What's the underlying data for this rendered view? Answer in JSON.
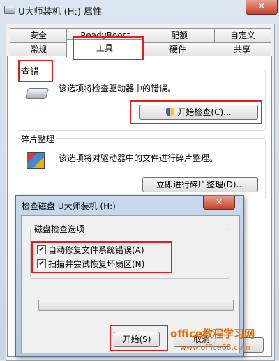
{
  "window": {
    "title": "U大师装机 (H:) 属性",
    "close_label": "✕"
  },
  "tabs_row1": [
    "安全",
    "ReadyBoost",
    "配额",
    "自定义"
  ],
  "tabs_row2": [
    "常规",
    "工具",
    "硬件",
    "共享"
  ],
  "active_tab": "工具",
  "check_section": {
    "label": "查错",
    "description": "该选项将检查驱动器中的错误。",
    "button_label": "开始检查(C)..."
  },
  "defrag_section": {
    "label": "碎片整理",
    "description": "该选项将对驱动器中的文件进行碎片整理。",
    "button_label": "立即进行碎片整理(D)..."
  },
  "dialog": {
    "title": "检查磁盘 U大师装机 (H:)",
    "close_label": "✕",
    "group_label": "磁盘检查选项",
    "options": [
      {
        "label": "自动修复文件系统错误(A)",
        "checked": true
      },
      {
        "label": "扫描并尝试恢复坏扇区(N)",
        "checked": true
      }
    ],
    "progress": 0,
    "start_button": "开始(S)",
    "cancel_button": "取消"
  },
  "watermark": {
    "line1": "office教程学习网",
    "line2": "www.office68.com"
  },
  "colors": {
    "highlight": "#e02020",
    "watermark": "#e66a00"
  }
}
